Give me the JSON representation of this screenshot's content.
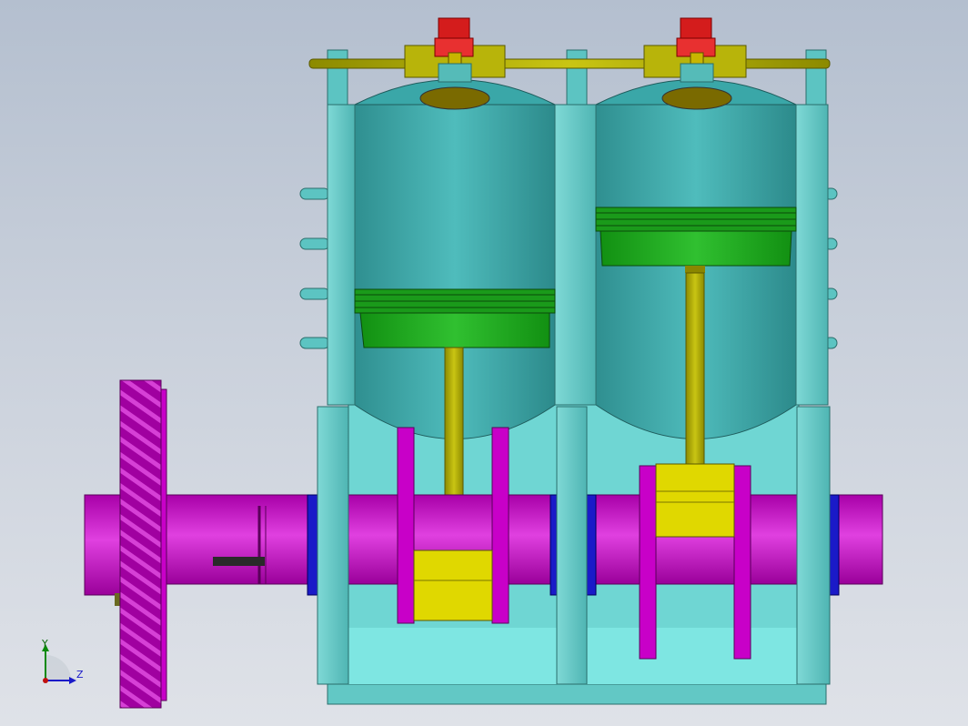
{
  "window": {
    "title": ""
  },
  "triad": {
    "y_label": "Y",
    "z_label": "Z"
  },
  "colors": {
    "background_top": "#b4bfcf",
    "background_bottom": "#dfe2e8",
    "frame": "#5cc4c2",
    "frame_light": "#8fe3e0",
    "cylinder": "#3aa7a8",
    "piston": "#22b022",
    "connecting_rod": "#b8b40a",
    "bearing": "#e8e000",
    "crankshaft": "#c800c8",
    "seal": "#1a1ac8",
    "valve": "#e02020",
    "flywheel": "#b000b0"
  },
  "icons": [
    "axis-triad-icon"
  ]
}
